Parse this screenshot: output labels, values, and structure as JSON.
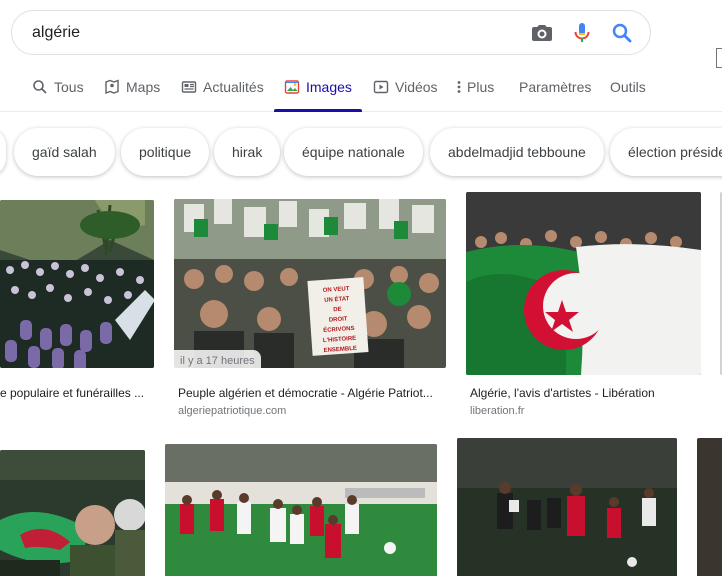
{
  "search": {
    "query": "algérie"
  },
  "tabs": [
    {
      "label": "Tous",
      "icon": "search-icon"
    },
    {
      "label": "Maps",
      "icon": "map-icon"
    },
    {
      "label": "Actualités",
      "icon": "news-icon"
    },
    {
      "label": "Images",
      "icon": "image-icon",
      "active": true
    },
    {
      "label": "Vidéos",
      "icon": "play-icon"
    },
    {
      "label": "Plus",
      "icon": "more-vert-icon"
    },
    {
      "label": "Paramètres"
    },
    {
      "label": "Outils"
    }
  ],
  "chips": [
    "gaïd salah",
    "politique",
    "hirak",
    "équipe nationale",
    "abdelmadjid tebboune",
    "élection préside"
  ],
  "results": [
    {
      "caption": "e populaire et funérailles ...",
      "domain": ""
    },
    {
      "caption": "Peuple algérien et démocratie - Algérie Patriot...",
      "domain": "algeriepatriotique.com",
      "badge": "il y a 17 heures",
      "sign": "ON VEUT UN ÉTAT DE DROIT ÉCRIVONS L'HISTOIRE ENSEMBLE"
    },
    {
      "caption": "Algérie, l'avis d'artistes - Libération",
      "domain": "liberation.fr"
    }
  ],
  "colors": {
    "accent": "#1a0dab",
    "flag_green": "#1d8a3a",
    "flag_red": "#d21034"
  }
}
